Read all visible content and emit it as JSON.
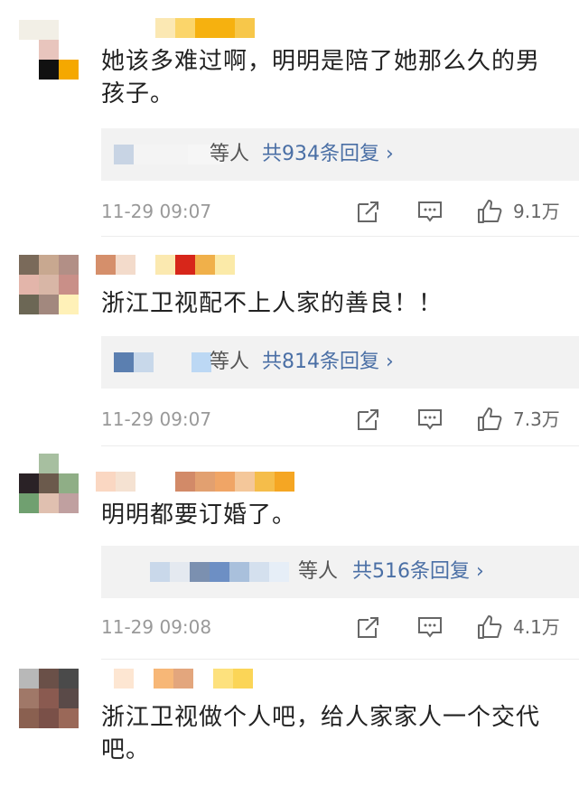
{
  "comments": [
    {
      "text": "她该多难过啊，明明是陪了她那么久的男孩子。",
      "reply_tail": "等人",
      "reply_count": "共934条回复 ›",
      "time": "11-29 09:07",
      "likes": "9.1万",
      "avatar_colors": [
        "#f2efe6",
        "#f2efe6",
        "#ffffff",
        "#ffffff",
        "#e8c5bd",
        "#ffffff",
        "#ffffff",
        "#111111",
        "#f5a800"
      ],
      "name_colors": [
        "#fbe8b3",
        "#fbd56a",
        "#f6b10f",
        "#f6b10f",
        "#f7c74a"
      ]
    },
    {
      "text": "浙江卫视配不上人家的善良！！",
      "reply_tail": "等人",
      "reply_count": "共814条回复 ›",
      "time": "11-29 09:07",
      "likes": "7.3万",
      "avatar_colors": [
        "#7a6a5a",
        "#c8a890",
        "#b28f86",
        "#e3b5aa",
        "#d8b6a6",
        "#c98f88",
        "#6c6755",
        "#a2887e",
        "#fff1b8"
      ],
      "name_colors": [
        "#d58f6b",
        "#f3dbcb",
        "#ffffff",
        "#fbe9b0",
        "#d7261a",
        "#f0b04a",
        "#fbeaa8"
      ]
    },
    {
      "text": "明明都要订婚了。",
      "reply_tail": "等人",
      "reply_count": "共516条回复 ›",
      "time": "11-29 09:08",
      "likes": "4.1万",
      "avatar_colors": [
        "#ffffff",
        "#a7bfa0",
        "#ffffff",
        "#2a2226",
        "#6b5a4c",
        "#8fae86",
        "#70a070",
        "#e0c0b0",
        "#c0a0a0"
      ],
      "name_colors": [
        "#fad7c2",
        "#f5e2d2",
        "#ffffff",
        "#ffffff",
        "#d28a68",
        "#e2a070",
        "#f0a566",
        "#f4c79a",
        "#f5bd4a",
        "#f5a623"
      ]
    },
    {
      "text": "浙江卫视做个人吧，给人家家人一个交代吧。",
      "avatar_colors": [
        "#b8b8b8",
        "#6a5048",
        "#4a4a4a",
        "#a07868",
        "#8a5a50",
        "#5a4a48",
        "#8a6050",
        "#7a5048",
        "#9a6858"
      ],
      "name_colors": [
        "#fde6d2",
        "#ffffff",
        "#f7b777",
        "#e3a67d",
        "#ffffff",
        "#fde17d",
        "#fbd557"
      ]
    }
  ],
  "icons": {
    "share": "share-icon",
    "comment": "comment-icon",
    "like": "thumb-up-icon"
  },
  "colors": {
    "reply_link": "#4a6fa5",
    "reply_bg": "#f2f2f2",
    "meta": "#999999"
  }
}
